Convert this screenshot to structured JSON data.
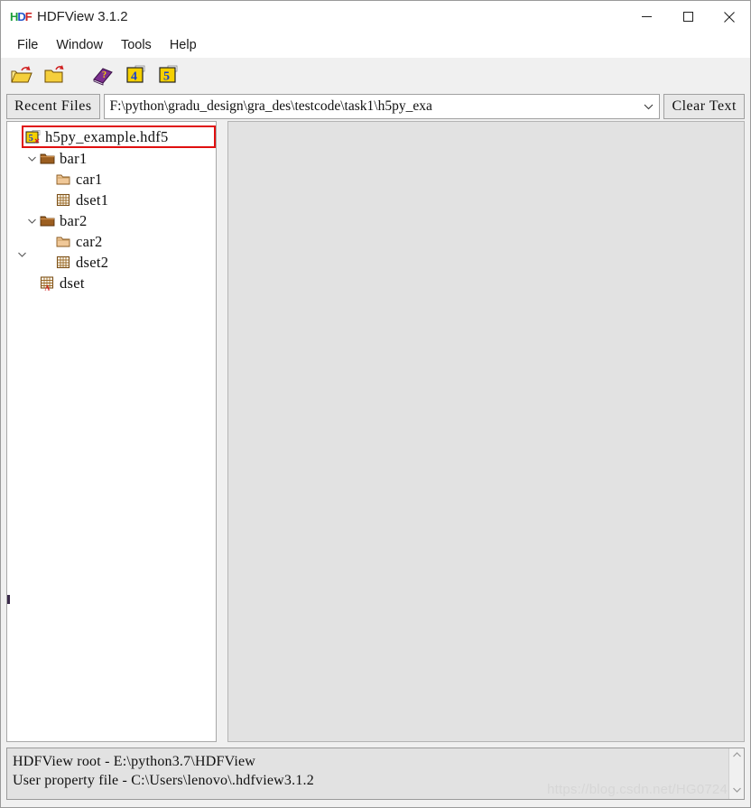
{
  "window": {
    "title": "HDFView 3.1.2",
    "logo_letters": [
      "H",
      "D",
      "F"
    ],
    "controls": {
      "minimize": "minimize-icon",
      "maximize": "maximize-icon",
      "close": "close-icon"
    }
  },
  "menubar": {
    "items": [
      {
        "label": "File"
      },
      {
        "label": "Window"
      },
      {
        "label": "Tools"
      },
      {
        "label": "Help"
      }
    ]
  },
  "toolbar": {
    "buttons": [
      {
        "name": "open-file-icon",
        "tip": "Open"
      },
      {
        "name": "open-folder-icon",
        "tip": "Open Folder"
      },
      {
        "name": "help-book-icon",
        "tip": "HDF Help"
      },
      {
        "name": "hdf4-library-icon",
        "tip": "HDF4 Library Version"
      },
      {
        "name": "hdf5-library-icon",
        "tip": "HDF5 Library Version"
      }
    ]
  },
  "recent_files": {
    "button_label": "Recent Files",
    "path_value": "F:\\python\\gradu_design\\gra_des\\testcode\\task1\\h5py_exa",
    "dropdown_icon": "chevron-down-icon",
    "clear_label": "Clear Text"
  },
  "tree": {
    "nodes": [
      {
        "label": "h5py_example.hdf5",
        "icon": "hdf5-file-icon",
        "depth": 0,
        "expanded": true,
        "selected": true
      },
      {
        "label": "bar1",
        "icon": "group-folder-icon",
        "depth": 1,
        "expanded": true,
        "selected": false
      },
      {
        "label": "car1",
        "icon": "subgroup-folder-icon",
        "depth": 2,
        "expanded": null,
        "selected": false
      },
      {
        "label": "dset1",
        "icon": "dataset-grid-icon",
        "depth": 2,
        "expanded": null,
        "selected": false
      },
      {
        "label": "bar2",
        "icon": "group-folder-icon",
        "depth": 1,
        "expanded": true,
        "selected": false
      },
      {
        "label": "car2",
        "icon": "subgroup-folder-icon",
        "depth": 2,
        "expanded": null,
        "selected": false
      },
      {
        "label": "dset2",
        "icon": "dataset-grid-icon",
        "depth": 2,
        "expanded": null,
        "selected": false
      },
      {
        "label": "dset",
        "icon": "dataset-attr-grid-icon",
        "depth": 1,
        "expanded": null,
        "selected": false
      }
    ],
    "selection_color": "#e01010"
  },
  "content": {
    "empty": ""
  },
  "status": {
    "lines": [
      "HDFView root - E:\\python3.7\\HDFView",
      "User property file - C:\\Users\\lenovo\\.hdfview3.1.2"
    ],
    "scroll_up_icon": "chevron-up-icon",
    "scroll_down_icon": "chevron-down-icon"
  },
  "watermark": {
    "text": "https://blog.csdn.net/HG0724"
  }
}
